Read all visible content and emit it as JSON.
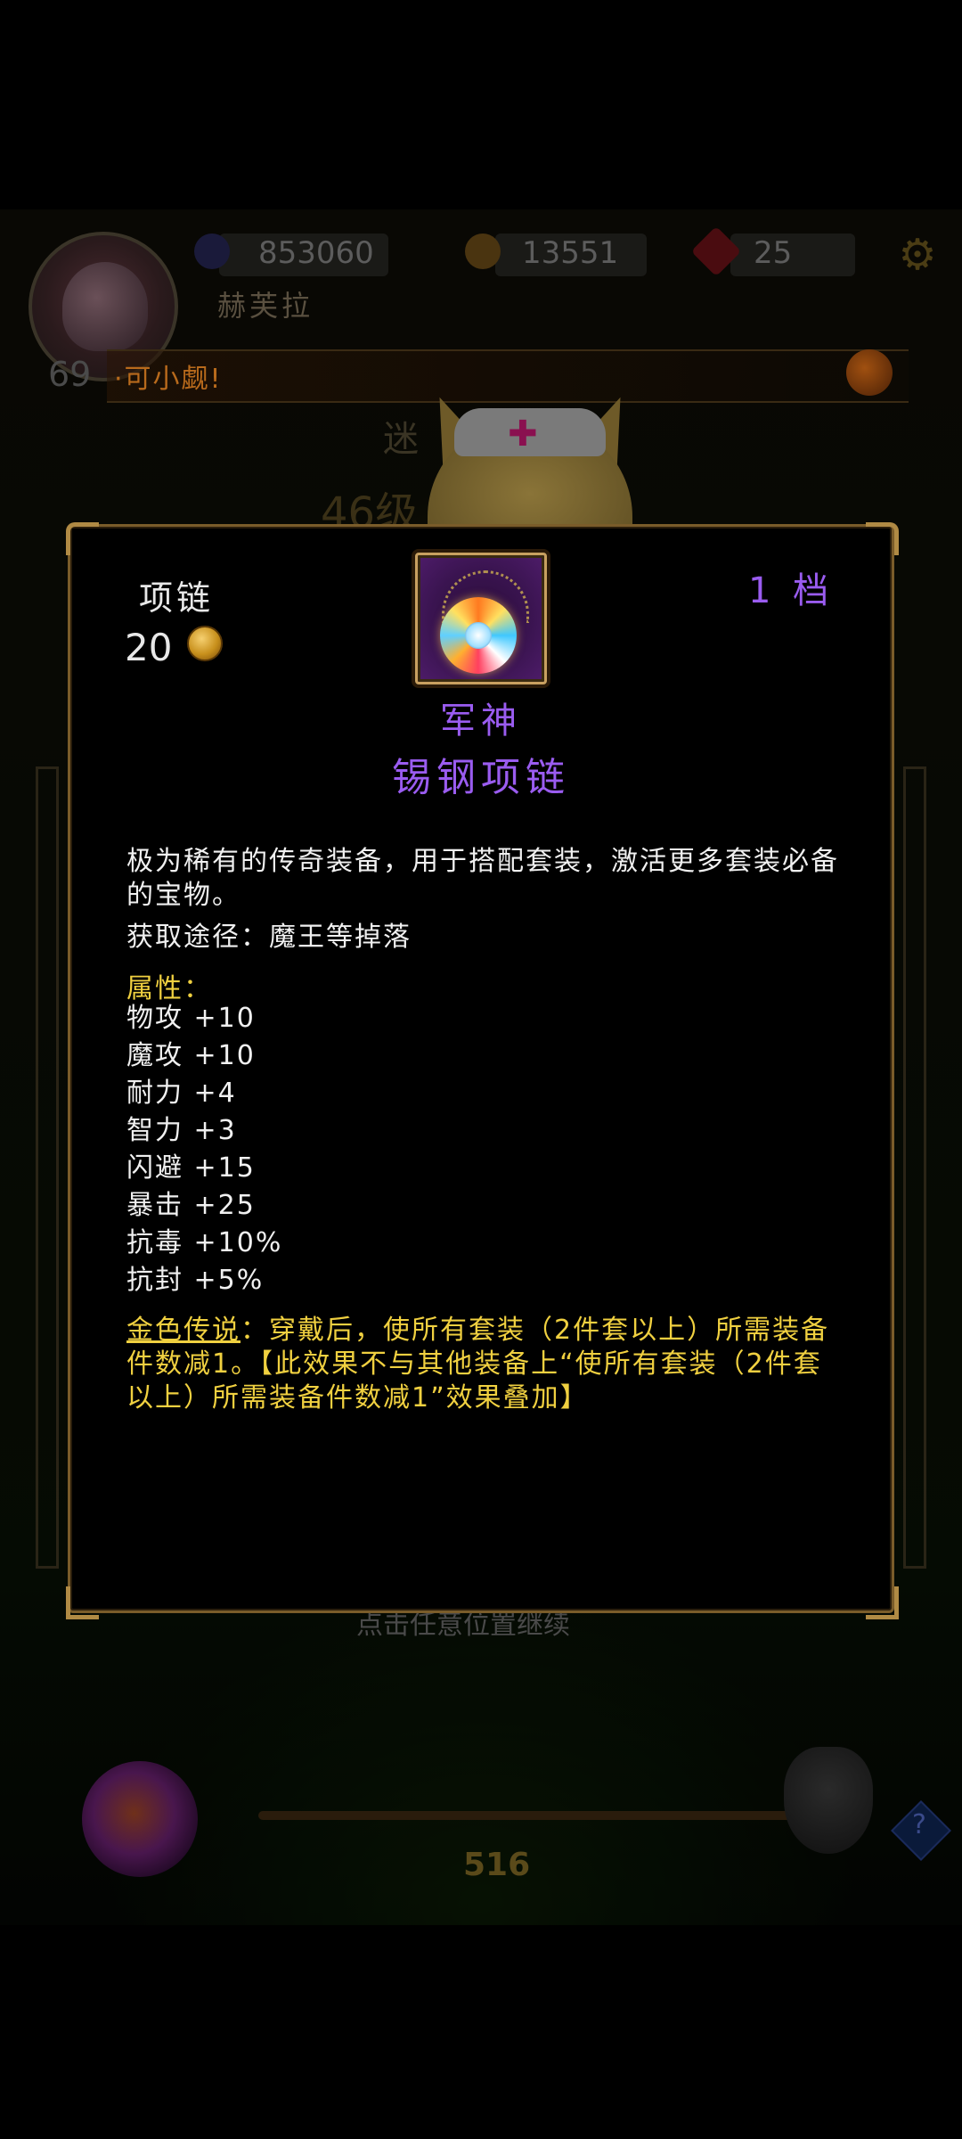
{
  "hud": {
    "diamonds": "853060",
    "gold": "13551",
    "gems": "25",
    "player_name": "赫芙拉",
    "level": "69",
    "marquee": "·可小觑!"
  },
  "background": {
    "stage_level": "46级",
    "glyph": "迷",
    "hint": "点击任意位置继续",
    "energy": "516"
  },
  "item": {
    "slot": "项链",
    "price": "20",
    "tier": "1 档",
    "set_name": "军神",
    "name": "锡钢项链",
    "description": "极为稀有的传奇装备，用于搭配套装，激活更多套装必备的宝物。",
    "source": "获取途径：魔王等掉落",
    "attributes_title": "属性：",
    "stats": [
      "物攻 +10",
      "魔攻 +10",
      "耐力 +4",
      "智力 +3",
      "闪避 +15",
      "暴击 +25",
      "抗毒 +10%",
      "抗封 +5%"
    ],
    "legend_title": "金色传说",
    "legend_text": "：穿戴后，使所有套装（2件套以上）所需装备件数减1。【此效果不与其他装备上“使所有套装（2件套以上）所需装备件数减1”效果叠加】"
  },
  "colors": {
    "purple": "#9a5cf0",
    "gold_text": "#f0d040",
    "frame": "#7a5c2a"
  },
  "icons": [
    "diamond-icon",
    "gold-coin-icon",
    "gem-icon",
    "gear-icon",
    "horn-icon",
    "help-icon",
    "necklace-icon"
  ]
}
